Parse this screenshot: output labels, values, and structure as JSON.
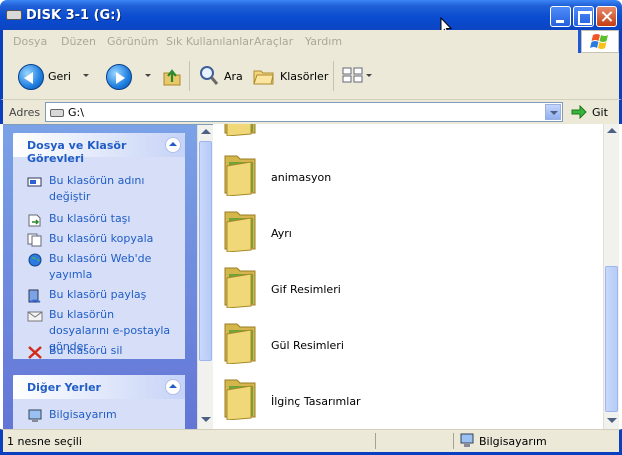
{
  "window": {
    "title": "DISK 3-1 (G:)"
  },
  "menu": [
    "Dosya",
    "Düzen",
    "Görünüm",
    "Sık Kullanılanlar",
    "Araçlar",
    "Yardım"
  ],
  "toolbar": {
    "back_label": "Geri",
    "search_label": "Ara",
    "folders_label": "Klasörler"
  },
  "address": {
    "label": "Adres",
    "value": "G:\\",
    "go_label": "Git"
  },
  "tasks": {
    "title": "Dosya ve Klasör Görevleri",
    "items": [
      {
        "label": "Bu klasörün adını değiştir",
        "icon": "rename-icon"
      },
      {
        "label": "Bu klasörü taşı",
        "icon": "move-icon"
      },
      {
        "label": "Bu klasörü kopyala",
        "icon": "copy-icon"
      },
      {
        "label": "Bu klasörü Web'de yayımla",
        "icon": "web-publish-icon"
      },
      {
        "label": "Bu klasörü paylaş",
        "icon": "share-icon"
      },
      {
        "label": "Bu klasörün dosyalarını e-postayla gönder",
        "icon": "email-icon"
      },
      {
        "label": "Bu klasörü sil",
        "icon": "delete-icon"
      }
    ]
  },
  "other_places": {
    "title": "Diğer Yerler",
    "items": [
      {
        "label": "Bilgisayarım",
        "icon": "my-computer-icon"
      }
    ]
  },
  "folders": [
    {
      "name": ""
    },
    {
      "name": "animasyon"
    },
    {
      "name": "Ayrı"
    },
    {
      "name": "Gif Resimleri"
    },
    {
      "name": "Gül Resimleri"
    },
    {
      "name": "İlginç Tasarımlar"
    }
  ],
  "status": {
    "selection": "1 nesne seçili",
    "zone": "Bilgisayarım"
  },
  "colors": {
    "title_blue": "#0a4bd0",
    "task_link": "#215dc6",
    "panel_bg": "#7ba2e7",
    "chrome": "#ece9d8"
  }
}
